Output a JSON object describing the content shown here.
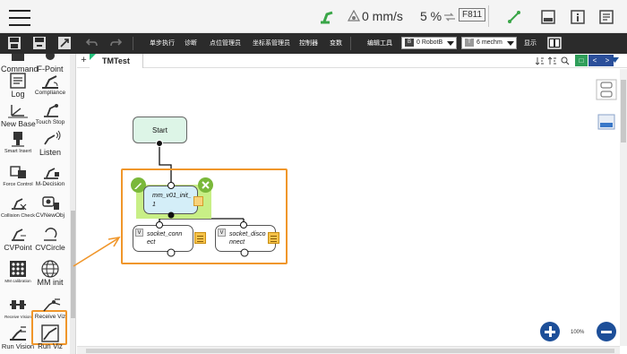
{
  "statusbar": {
    "speed": "0 mm/s",
    "percent": "5 %",
    "fkey": "F811"
  },
  "toolbar": {
    "menu": [
      "单步执行",
      "诊断",
      "点位管理员",
      "坐标系管理员",
      "控制器",
      "变数",
      "编辑工具",
      "显示"
    ],
    "base_dropdown": {
      "chip": "B",
      "value": "0 RobotB"
    },
    "tcp_dropdown": {
      "chip": "T",
      "value": "6 mechm"
    }
  },
  "sidebar": {
    "items": [
      {
        "label": "Command",
        "icon": "command-icon"
      },
      {
        "label": "F-Point",
        "icon": "f-point-icon"
      },
      {
        "label": "Log",
        "icon": "log-icon"
      },
      {
        "label": "Compliance",
        "icon": "compliance-icon"
      },
      {
        "label": "New Base",
        "icon": "new-base-icon"
      },
      {
        "label": "Touch Stop",
        "icon": "touch-stop-icon"
      },
      {
        "label": "Smart Insert",
        "icon": "smart-insert-icon"
      },
      {
        "label": "Listen",
        "icon": "listen-icon"
      },
      {
        "label": "Force Control",
        "icon": "force-control-icon"
      },
      {
        "label": "M-Decision",
        "icon": "m-decision-icon"
      },
      {
        "label": "Collision Check",
        "icon": "collision-check-icon"
      },
      {
        "label": "CVNewObj",
        "icon": "cv-new-obj-icon"
      },
      {
        "label": "CVPoint",
        "icon": "cv-point-icon"
      },
      {
        "label": "CVCircle",
        "icon": "cv-circle-icon"
      },
      {
        "label": "MM calibration",
        "icon": "mm-calibration-icon"
      },
      {
        "label": "MM init",
        "icon": "mm-init-icon"
      },
      {
        "label": "Receive Vision",
        "icon": "receive-vision-icon"
      },
      {
        "label": "Receive Viz",
        "icon": "receive-viz-icon"
      },
      {
        "label": "Run Vision",
        "icon": "run-vision-icon"
      },
      {
        "label": "Run Viz",
        "icon": "run-viz-icon"
      }
    ]
  },
  "tabs": {
    "add": "+",
    "active": "TMTest"
  },
  "flow": {
    "start": "Start",
    "init": "mm_v01_init_1",
    "init_l1": "mm_v01_init_",
    "init_l2": "1",
    "connect_badge": "V",
    "connect_l1": "socket_conn",
    "connect_l2": "ect",
    "disconnect_badge": "V",
    "disconnect_l1": "socket_disco",
    "disconnect_l2": "nnect"
  },
  "zoom": {
    "level": "100%"
  },
  "colors": {
    "accent_orange": "#f0962a",
    "toolbar_bg": "#2b2b2b",
    "start_fill": "#ddf5e7",
    "init_fill": "#d4eef8",
    "selection_fill": "#c8ef86",
    "zoom_button": "#1d4f99",
    "active_tab_flag": "#22c07a"
  }
}
